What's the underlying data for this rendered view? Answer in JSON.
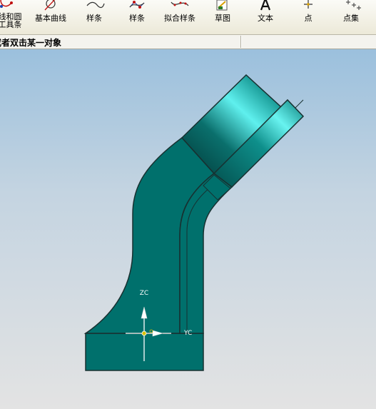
{
  "toolbar": {
    "items": [
      {
        "label": "线和圆\n工具条",
        "icon": "line-circle-icon"
      },
      {
        "label": "基本曲线",
        "icon": "basic-curve-icon"
      },
      {
        "label": "样条",
        "icon": "spline-icon"
      },
      {
        "label": "样条",
        "icon": "spline-poles-icon"
      },
      {
        "label": "拟合样条",
        "icon": "fit-spline-icon"
      },
      {
        "label": "草图",
        "icon": "sketch-icon"
      },
      {
        "label": "文本",
        "icon": "text-icon"
      },
      {
        "label": "点",
        "icon": "point-icon"
      },
      {
        "label": "点集",
        "icon": "point-set-icon"
      }
    ]
  },
  "status": {
    "prompt": "或者双击某一对象"
  },
  "viewport": {
    "axes": {
      "z_label": "ZC",
      "y_label": "YC"
    },
    "colors": {
      "body": "#00706c",
      "cylinder_highlight": "#5ff0ee",
      "cylinder_shadow": "#023b3a",
      "edge": "#183030"
    }
  }
}
